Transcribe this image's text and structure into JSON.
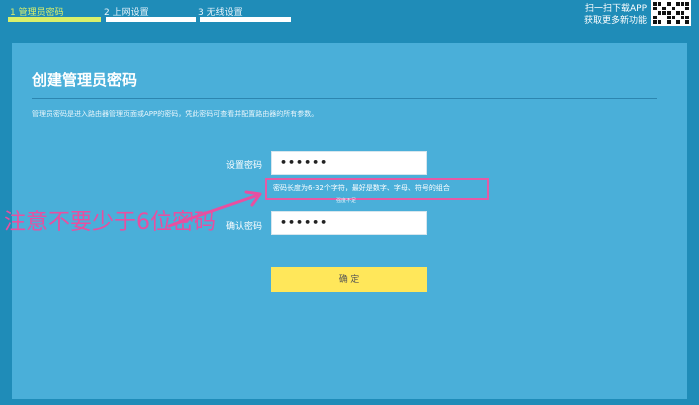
{
  "steps": [
    {
      "label": "1 管理员密码",
      "active": true
    },
    {
      "label": "2 上网设置",
      "active": false
    },
    {
      "label": "3 无线设置",
      "active": false
    }
  ],
  "app_promo": {
    "line1": "扫一扫下载APP",
    "line2": "获取更多新功能"
  },
  "panel": {
    "title": "创建管理员密码",
    "description": "管理员密码是进入路由器管理页面或APP的密码，凭此密码可查看并配置路由器的所有参数。"
  },
  "form": {
    "password_label": "设置密码",
    "password_value": "••••••",
    "hint": "密码长度为6-32个字符，最好是数字、字母、符号的组合",
    "strength": "强度不足",
    "confirm_label": "确认密码",
    "confirm_value": "••••••",
    "submit_label": "确 定"
  },
  "annotation": {
    "text": "注意不要少于6位密码",
    "color": "#e84fa0"
  },
  "colors": {
    "background": "#1f8cb8",
    "panel": "#4aafd9",
    "active_step": "#d9f06b",
    "button": "#ffe75a"
  }
}
